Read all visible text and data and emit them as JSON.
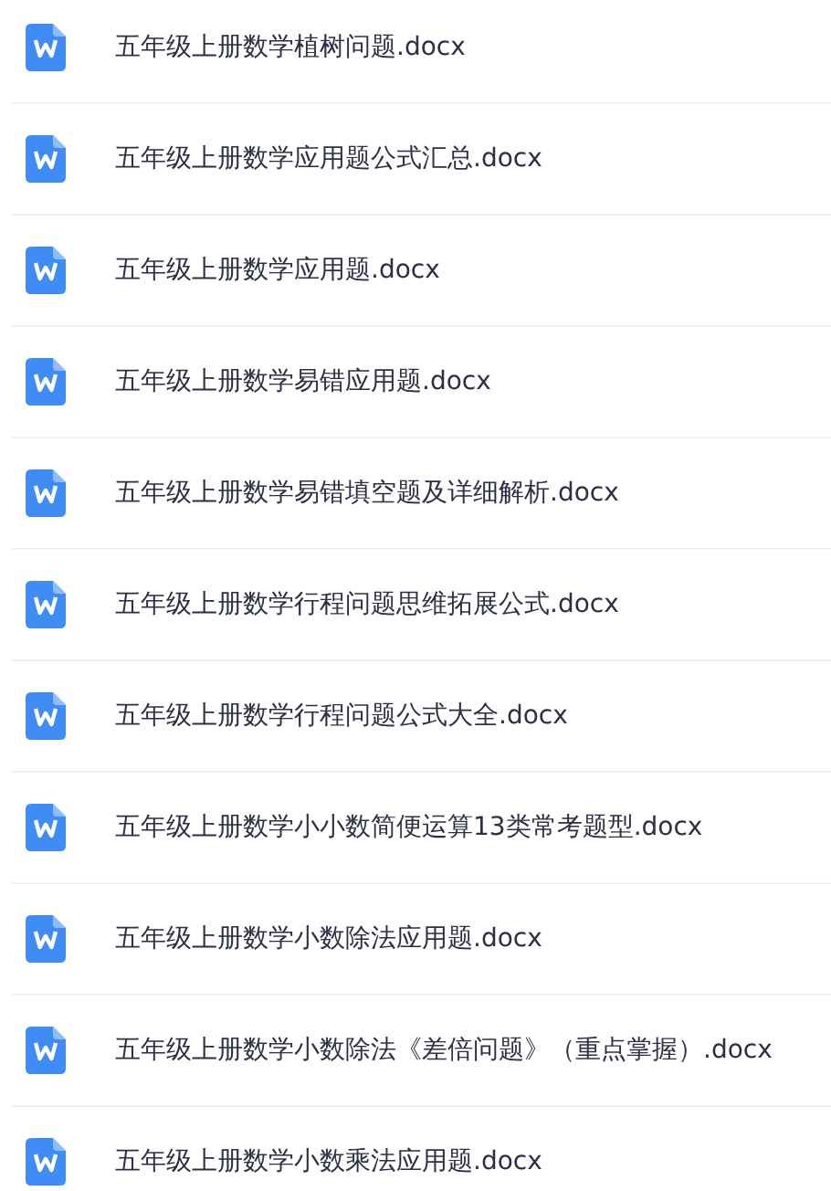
{
  "files": [
    {
      "name": "五年级上册数学植树问题.docx"
    },
    {
      "name": "五年级上册数学应用题公式汇总.docx"
    },
    {
      "name": "五年级上册数学应用题.docx"
    },
    {
      "name": "五年级上册数学易错应用题.docx"
    },
    {
      "name": "五年级上册数学易错填空题及详细解析.docx"
    },
    {
      "name": "五年级上册数学行程问题思维拓展公式.docx"
    },
    {
      "name": "五年级上册数学行程问题公式大全.docx"
    },
    {
      "name": "五年级上册数学小小数简便运算13类常考题型.docx"
    },
    {
      "name": "五年级上册数学小数除法应用题.docx"
    },
    {
      "name": "五年级上册数学小数除法《差倍问题》（重点掌握）.docx"
    },
    {
      "name": "五年级上册数学小数乘法应用题.docx"
    }
  ]
}
